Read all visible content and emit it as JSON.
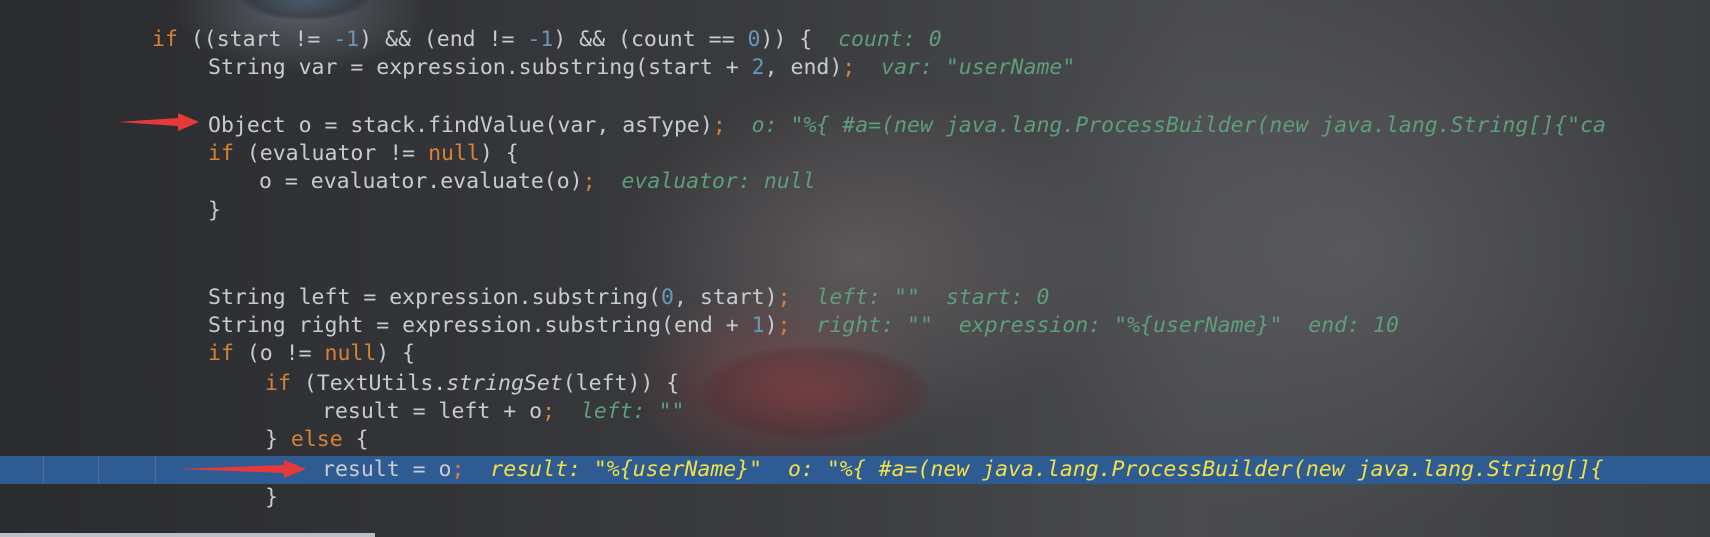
{
  "editor": {
    "lines": [
      {
        "tokens": [
          {
            "t": "if",
            "c": "kw"
          },
          {
            "t": " ((start != "
          },
          {
            "t": "-1",
            "c": "num"
          },
          {
            "t": ") && (end != "
          },
          {
            "t": "-1",
            "c": "num"
          },
          {
            "t": ") && (count == "
          },
          {
            "t": "0",
            "c": "num"
          },
          {
            "t": ")) {"
          }
        ],
        "hint": "count: 0"
      },
      {
        "tokens": [
          {
            "t": "String var = expression.substring(start + "
          },
          {
            "t": "2",
            "c": "num"
          },
          {
            "t": ", end)"
          },
          {
            "t": ";",
            "c": "kw"
          }
        ],
        "hint": "var: \"userName\""
      },
      {
        "tokens": [],
        "hint": ""
      },
      {
        "tokens": [
          {
            "t": "Object o = stack.findValue(var, asType)"
          },
          {
            "t": ";",
            "c": "kw"
          }
        ],
        "hint": "o: \"%{ #a=(new java.lang.ProcessBuilder(new java.lang.String[]{\"ca"
      },
      {
        "tokens": [
          {
            "t": "if",
            "c": "kw"
          },
          {
            "t": " (evaluator != "
          },
          {
            "t": "null",
            "c": "kw"
          },
          {
            "t": ") {"
          }
        ],
        "hint": ""
      },
      {
        "tokens": [
          {
            "t": "o = evaluator.evaluate(o)"
          },
          {
            "t": ";",
            "c": "kw"
          }
        ],
        "hint": "evaluator: null"
      },
      {
        "tokens": [
          {
            "t": "}"
          }
        ],
        "hint": ""
      },
      {
        "tokens": [],
        "hint": ""
      },
      {
        "tokens": [],
        "hint": ""
      },
      {
        "tokens": [
          {
            "t": "String left = expression.substring("
          },
          {
            "t": "0",
            "c": "num"
          },
          {
            "t": ", start)"
          },
          {
            "t": ";",
            "c": "kw"
          }
        ],
        "hint": "left: \"\"  start: 0"
      },
      {
        "tokens": [
          {
            "t": "String right = expression.substring(end + "
          },
          {
            "t": "1",
            "c": "num"
          },
          {
            "t": ")"
          },
          {
            "t": ";",
            "c": "kw"
          }
        ],
        "hint": "right: \"\"  expression: \"%{userName}\"  end: 10"
      },
      {
        "tokens": [
          {
            "t": "if",
            "c": "kw"
          },
          {
            "t": " (o != "
          },
          {
            "t": "null",
            "c": "kw"
          },
          {
            "t": ") {"
          }
        ],
        "hint": ""
      },
      {
        "tokens": [
          {
            "t": "if",
            "c": "kw"
          },
          {
            "t": " (TextUtils."
          },
          {
            "t": "stringSet",
            "c": "it"
          },
          {
            "t": "(left)) {"
          }
        ],
        "hint": ""
      },
      {
        "tokens": [
          {
            "t": "result = left + o"
          },
          {
            "t": ";",
            "c": "kw"
          }
        ],
        "hint": "left: \"\""
      },
      {
        "tokens": [
          {
            "t": "} "
          },
          {
            "t": "else",
            "c": "kw"
          },
          {
            "t": " {"
          }
        ],
        "hint": ""
      },
      {
        "tokens": [
          {
            "t": "result = o"
          },
          {
            "t": ";",
            "c": "kw"
          }
        ],
        "hint": "result: \"%{userName}\"  o: \"%{ #a=(new java.lang.ProcessBuilder(new java.lang.String[]{"
      },
      {
        "tokens": [
          {
            "t": "}"
          }
        ],
        "hint": ""
      }
    ]
  },
  "colors": {
    "keyword": "#d68335",
    "number": "#6897bb",
    "hint": "#5f9e7a",
    "exec_line_bg": "#2f5b93",
    "exec_hint": "#f1e04a",
    "arrow": "#e63a3a"
  }
}
